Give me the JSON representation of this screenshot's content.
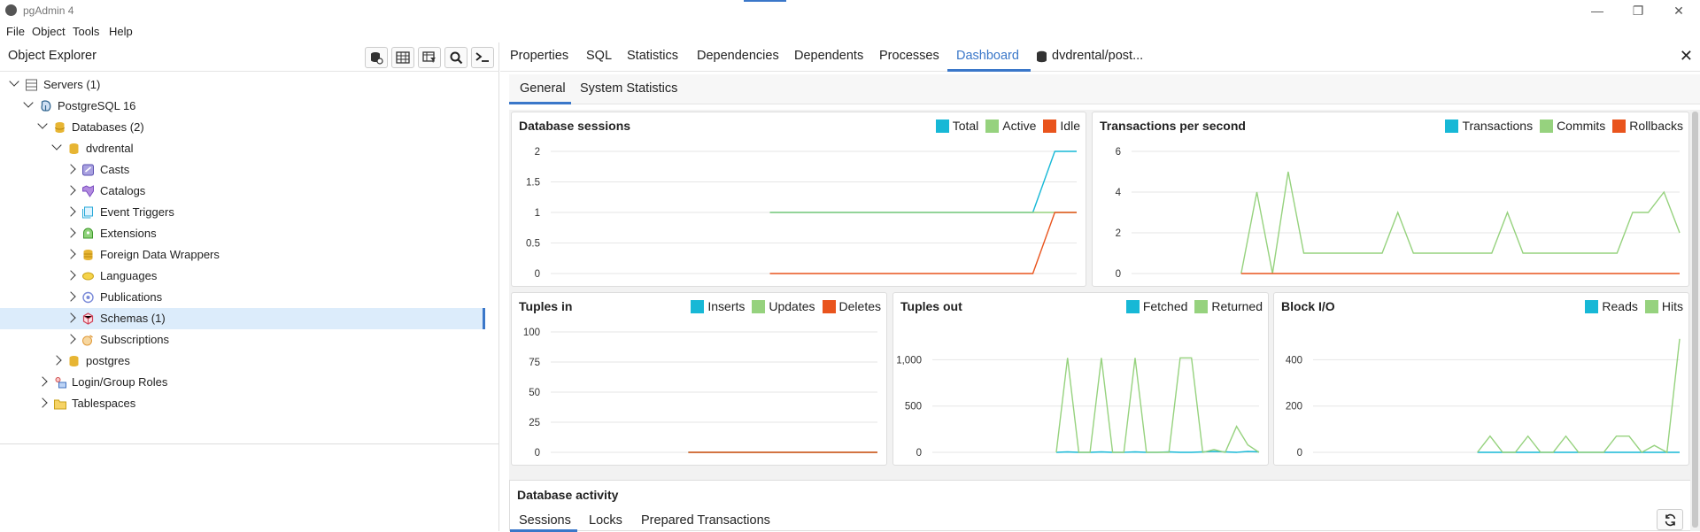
{
  "window": {
    "title": "pgAdmin 4"
  },
  "menu": [
    "File",
    "Object",
    "Tools",
    "Help"
  ],
  "object_explorer": {
    "title": "Object Explorer",
    "tree": [
      {
        "label": "Servers (1)",
        "level": 0,
        "state": "down",
        "icon": "servers-icon"
      },
      {
        "label": "PostgreSQL 16",
        "level": 1,
        "state": "down",
        "icon": "postgres-elephant-icon"
      },
      {
        "label": "Databases (2)",
        "level": 2,
        "state": "down",
        "icon": "databases-icon"
      },
      {
        "label": "dvdrental",
        "level": 3,
        "state": "down",
        "icon": "database-icon"
      },
      {
        "label": "Casts",
        "level": 4,
        "state": "right",
        "icon": "casts-icon"
      },
      {
        "label": "Catalogs",
        "level": 4,
        "state": "right",
        "icon": "catalogs-icon"
      },
      {
        "label": "Event Triggers",
        "level": 4,
        "state": "right",
        "icon": "event-triggers-icon"
      },
      {
        "label": "Extensions",
        "level": 4,
        "state": "right",
        "icon": "extensions-icon"
      },
      {
        "label": "Foreign Data Wrappers",
        "level": 4,
        "state": "right",
        "icon": "foreign-data-wrappers-icon"
      },
      {
        "label": "Languages",
        "level": 4,
        "state": "right",
        "icon": "languages-icon"
      },
      {
        "label": "Publications",
        "level": 4,
        "state": "right",
        "icon": "publications-icon"
      },
      {
        "label": "Schemas (1)",
        "level": 4,
        "state": "right",
        "icon": "schemas-icon",
        "selected": true
      },
      {
        "label": "Subscriptions",
        "level": 4,
        "state": "right",
        "icon": "subscriptions-icon"
      },
      {
        "label": "postgres",
        "level": 3,
        "state": "right",
        "icon": "database-icon"
      },
      {
        "label": "Login/Group Roles",
        "level": 2,
        "state": "right",
        "icon": "roles-icon"
      },
      {
        "label": "Tablespaces",
        "level": 2,
        "state": "right",
        "icon": "tablespaces-icon"
      }
    ]
  },
  "tabs": [
    "Properties",
    "SQL",
    "Statistics",
    "Dependencies",
    "Dependents",
    "Processes",
    "Dashboard",
    "dvdrental/post..."
  ],
  "active_tab": "Dashboard",
  "subtabs": [
    "General",
    "System Statistics"
  ],
  "activity": {
    "title": "Database activity",
    "tabs": [
      "Sessions",
      "Locks",
      "Prepared Transactions"
    ]
  },
  "colors": {
    "cyan": "#17b8d6",
    "green": "#96d27e",
    "orange": "#e9541d",
    "accent": "#3a77c9"
  },
  "chart_data": [
    {
      "type": "line",
      "title": "Database sessions",
      "ylim": [
        0,
        2
      ],
      "yticks": [
        "0",
        "0.5",
        "1",
        "1.5",
        "2"
      ],
      "x": [
        0,
        1,
        2,
        3,
        4,
        5,
        6,
        7,
        8,
        9,
        10,
        11,
        12,
        13,
        14,
        15,
        16,
        17,
        18,
        19,
        20,
        21,
        22,
        23,
        24
      ],
      "series": [
        {
          "name": "Total",
          "color": "#17b8d6",
          "values": [
            null,
            null,
            null,
            null,
            null,
            null,
            null,
            null,
            null,
            null,
            1,
            1,
            1,
            1,
            1,
            1,
            1,
            1,
            1,
            1,
            1,
            1,
            1,
            2,
            2
          ]
        },
        {
          "name": "Active",
          "color": "#96d27e",
          "values": [
            null,
            null,
            null,
            null,
            null,
            null,
            null,
            null,
            null,
            null,
            1,
            1,
            1,
            1,
            1,
            1,
            1,
            1,
            1,
            1,
            1,
            1,
            1,
            1,
            1
          ]
        },
        {
          "name": "Idle",
          "color": "#e9541d",
          "values": [
            null,
            null,
            null,
            null,
            null,
            null,
            null,
            null,
            null,
            null,
            0,
            0,
            0,
            0,
            0,
            0,
            0,
            0,
            0,
            0,
            0,
            0,
            0,
            1,
            1
          ]
        }
      ]
    },
    {
      "type": "line",
      "title": "Transactions per second",
      "ylim": [
        0,
        6
      ],
      "yticks": [
        "0",
        "2",
        "4",
        "6"
      ],
      "x": [
        0,
        1,
        2,
        3,
        4,
        5,
        6,
        7,
        8,
        9,
        10,
        11,
        12,
        13,
        14,
        15,
        16,
        17,
        18,
        19,
        20,
        21,
        22,
        23,
        24,
        25,
        26,
        27,
        28,
        29,
        30,
        31,
        32,
        33,
        34,
        35
      ],
      "series": [
        {
          "name": "Transactions",
          "color": "#17b8d6",
          "values": [
            null,
            null,
            null,
            null,
            null,
            null,
            null,
            null,
            null,
            null,
            null,
            null,
            null,
            null,
            null,
            null,
            null,
            null,
            null,
            null,
            null,
            null,
            null,
            null,
            null,
            null,
            null,
            null,
            null,
            null,
            null,
            null,
            null,
            null,
            null,
            null
          ]
        },
        {
          "name": "Commits",
          "color": "#96d27e",
          "values": [
            null,
            null,
            null,
            null,
            null,
            null,
            null,
            0,
            4,
            0,
            5,
            1,
            1,
            1,
            1,
            1,
            1,
            3,
            1,
            1,
            1,
            1,
            1,
            1,
            3,
            1,
            1,
            1,
            1,
            1,
            1,
            1,
            3,
            3,
            4,
            2
          ]
        },
        {
          "name": "Rollbacks",
          "color": "#e9541d",
          "values": [
            null,
            null,
            null,
            null,
            null,
            null,
            null,
            0,
            0,
            0,
            0,
            0,
            0,
            0,
            0,
            0,
            0,
            0,
            0,
            0,
            0,
            0,
            0,
            0,
            0,
            0,
            0,
            0,
            0,
            0,
            0,
            0,
            0,
            0,
            0,
            0
          ]
        }
      ]
    },
    {
      "type": "line",
      "title": "Tuples in",
      "ylim": [
        0,
        100
      ],
      "yticks": [
        "0",
        "25",
        "50",
        "75",
        "100"
      ],
      "x": [
        0,
        1,
        2,
        3,
        4,
        5,
        6,
        7,
        8,
        9,
        10,
        11,
        12,
        13,
        14,
        15,
        16,
        17,
        18,
        19
      ],
      "series": [
        {
          "name": "Inserts",
          "color": "#17b8d6",
          "values": [
            null,
            null,
            null,
            null,
            null,
            null,
            null,
            null,
            0,
            0,
            0,
            0,
            0,
            0,
            0,
            0,
            0,
            0,
            0,
            0
          ]
        },
        {
          "name": "Updates",
          "color": "#96d27e",
          "values": [
            null,
            null,
            null,
            null,
            null,
            null,
            null,
            null,
            0,
            0,
            0,
            0,
            0,
            0,
            0,
            0,
            0,
            0,
            0,
            0
          ]
        },
        {
          "name": "Deletes",
          "color": "#e9541d",
          "values": [
            null,
            null,
            null,
            null,
            null,
            null,
            null,
            null,
            0,
            0,
            0,
            0,
            0,
            0,
            0,
            0,
            0,
            0,
            0,
            0
          ]
        }
      ]
    },
    {
      "type": "line",
      "title": "Tuples out",
      "ylim": [
        0,
        1300
      ],
      "yticks": [
        "0",
        "500",
        "1,000"
      ],
      "x": [
        0,
        1,
        2,
        3,
        4,
        5,
        6,
        7,
        8,
        9,
        10,
        11,
        12,
        13,
        14,
        15,
        16,
        17,
        18,
        19,
        20,
        21,
        22,
        23,
        24,
        25,
        26,
        27,
        28,
        29
      ],
      "series": [
        {
          "name": "Fetched",
          "color": "#17b8d6",
          "values": [
            null,
            null,
            null,
            null,
            null,
            null,
            null,
            null,
            null,
            null,
            null,
            0,
            5,
            0,
            0,
            5,
            0,
            0,
            5,
            0,
            0,
            5,
            0,
            0,
            5,
            10,
            5,
            0,
            10,
            5
          ]
        },
        {
          "name": "Returned",
          "color": "#96d27e",
          "values": [
            null,
            null,
            null,
            null,
            null,
            null,
            null,
            null,
            null,
            null,
            null,
            0,
            1020,
            0,
            0,
            1020,
            0,
            0,
            1020,
            0,
            0,
            0,
            1020,
            1020,
            0,
            30,
            0,
            280,
            80,
            0
          ]
        }
      ]
    },
    {
      "type": "line",
      "title": "Block I/O",
      "ylim": [
        0,
        520
      ],
      "yticks": [
        "0",
        "200",
        "400"
      ],
      "x": [
        0,
        1,
        2,
        3,
        4,
        5,
        6,
        7,
        8,
        9,
        10,
        11,
        12,
        13,
        14,
        15,
        16,
        17,
        18,
        19,
        20,
        21,
        22,
        23,
        24,
        25,
        26,
        27,
        28,
        29
      ],
      "series": [
        {
          "name": "Reads",
          "color": "#17b8d6",
          "values": [
            null,
            null,
            null,
            null,
            null,
            null,
            null,
            null,
            null,
            null,
            null,
            null,
            null,
            0,
            0,
            0,
            0,
            0,
            0,
            0,
            0,
            0,
            0,
            0,
            0,
            0,
            0,
            0,
            0,
            0
          ]
        },
        {
          "name": "Hits",
          "color": "#96d27e",
          "values": [
            null,
            null,
            null,
            null,
            null,
            null,
            null,
            null,
            null,
            null,
            null,
            null,
            null,
            0,
            70,
            0,
            0,
            70,
            0,
            0,
            70,
            0,
            0,
            0,
            70,
            70,
            0,
            30,
            0,
            490
          ]
        }
      ]
    }
  ]
}
